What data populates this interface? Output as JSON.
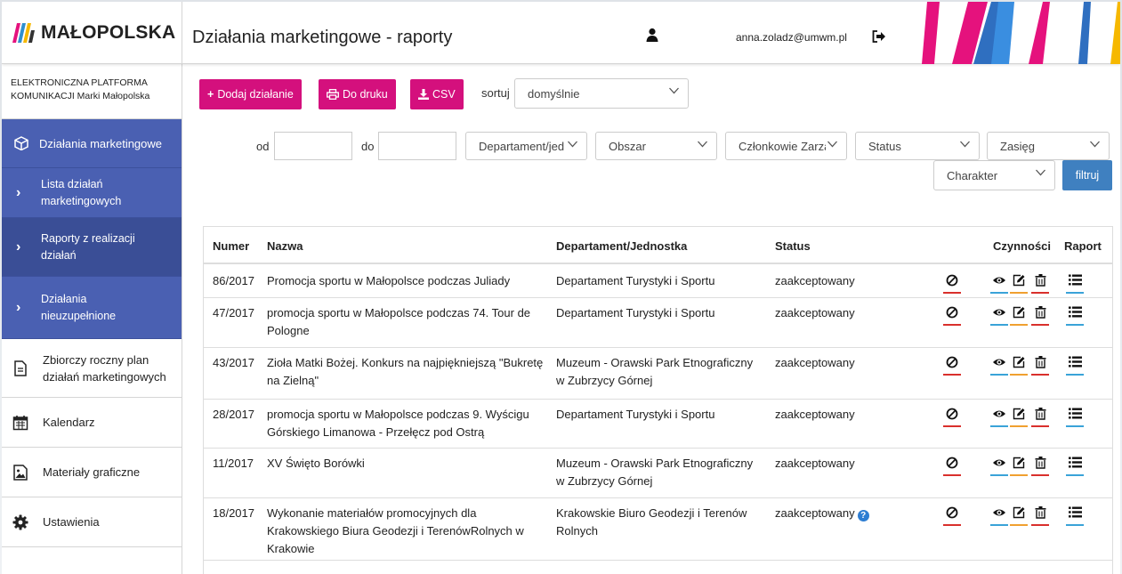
{
  "header": {
    "logo_text": "MAŁOPOLSKA",
    "title": "Działania marketingowe - raporty",
    "user_email": "anna.zoladz@umwm.pl"
  },
  "sidebar": {
    "platform_line1": "ELEKTRONICZNA PLATFORMA",
    "platform_line2": "KOMUNIKACJI Marki Małopolska",
    "main_item": "Działania marketingowe",
    "sub_items": [
      {
        "line1": "Lista działań",
        "line2": "marketingowych"
      },
      {
        "line1": "Raporty z realizacji",
        "line2": "działań"
      },
      {
        "line1": "Działania",
        "line2": "nieuzupełnione"
      }
    ],
    "items": [
      {
        "line1": "Zbiorczy roczny plan",
        "line2": "działań marketingowych",
        "icon": "document-icon"
      },
      {
        "line1": "Kalendarz",
        "line2": "",
        "icon": "calendar-icon"
      },
      {
        "line1": "Materiały graficzne",
        "line2": "",
        "icon": "image-icon"
      },
      {
        "line1": "Ustawienia",
        "line2": "",
        "icon": "gear-icon"
      }
    ]
  },
  "toolbar": {
    "add_label": "Dodaj działanie",
    "print_label": "Do druku",
    "csv_label": "CSV",
    "sort_label": "sortuj",
    "sort_value": "domyślnie"
  },
  "filters": {
    "from_label": "od",
    "to_label": "do",
    "department": "Departament/jednostka",
    "area": "Obszar",
    "members": "Członkowie Zarządu",
    "status": "Status",
    "scope": "Zasięg",
    "character": "Charakter",
    "filter_button": "filtruj"
  },
  "table": {
    "columns": {
      "number": "Numer",
      "name": "Nazwa",
      "department": "Departament/Jednostka",
      "status": "Status",
      "actions": "Czynności",
      "report": "Raport"
    },
    "rows": [
      {
        "number": "86/2017",
        "name": "Promocja sportu w Małopolsce podczas Juliady",
        "department": "Departament Turystyki i Sportu",
        "status": "zaakceptowany"
      },
      {
        "number": "47/2017",
        "name": "promocja sportu w Małopolsce podczas 74. Tour de Pologne",
        "department": "Departament Turystyki i Sportu",
        "status": "zaakceptowany"
      },
      {
        "number": "43/2017",
        "name": "Zioła Matki Bożej. Konkurs na najpiękniejszą \"Bukretę na Zielną\"",
        "department": "Muzeum - Orawski Park Etnograficzny w Zubrzycy Górnej",
        "status": "zaakceptowany"
      },
      {
        "number": "28/2017",
        "name": "promocja sportu w Małopolsce podczas 9. Wyścigu Górskiego Limanowa - Przełęcz pod Ostrą",
        "department": "Departament Turystyki i Sportu",
        "status": "zaakceptowany"
      },
      {
        "number": "11/2017",
        "name": "XV Święto Borówki",
        "department": "Muzeum - Orawski Park Etnograficzny w Zubrzycy Górnej",
        "status": "zaakceptowany"
      },
      {
        "number": "18/2017",
        "name": "Wykonanie materiałów promocyjnych dla Krakowskiego Biura Geodezji i TerenówRolnych w Krakowie",
        "department": "Krakowskie Biuro Geodezji i Terenów Rolnych",
        "status": "zaakceptowany",
        "status_help": "?"
      }
    ]
  },
  "colors": {
    "accent_pink": "#d4107d",
    "nav_blue": "#4a60b2",
    "filter_blue": "#3f80c0",
    "action_red": "#d9302c",
    "action_blue": "#3aa3d8",
    "action_orange": "#f0a030"
  }
}
